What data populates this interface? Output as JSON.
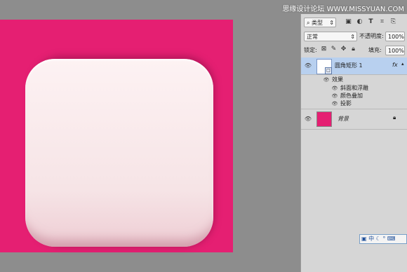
{
  "watermark": "思缘设计论坛 WWW.MISSYUAN.COM",
  "colors": {
    "canvas": "#e51f72",
    "panel": "#d6d6d6",
    "selected_layer": "#b8d0ef"
  },
  "layers_panel": {
    "filter_kind": "类型",
    "filter_icons": [
      "image-filter-icon",
      "adjustment-filter-icon",
      "type-filter-icon",
      "shape-filter-icon",
      "smart-object-filter-icon"
    ],
    "blend_mode": "正常",
    "opacity_label": "不透明度:",
    "opacity_value": "100%",
    "lock_label": "锁定:",
    "fill_label": "填充:",
    "fill_value": "100%",
    "layers": [
      {
        "name": "圆角矩形 1",
        "fx": "fx",
        "selected": true,
        "effects_label": "效果",
        "effects": [
          "斜面和浮雕",
          "颜色叠加",
          "投影"
        ]
      },
      {
        "name": "背景",
        "locked": true,
        "thumb_color": "#e51f72"
      }
    ]
  },
  "ime_bar": "中 ☾ ° ⌨"
}
